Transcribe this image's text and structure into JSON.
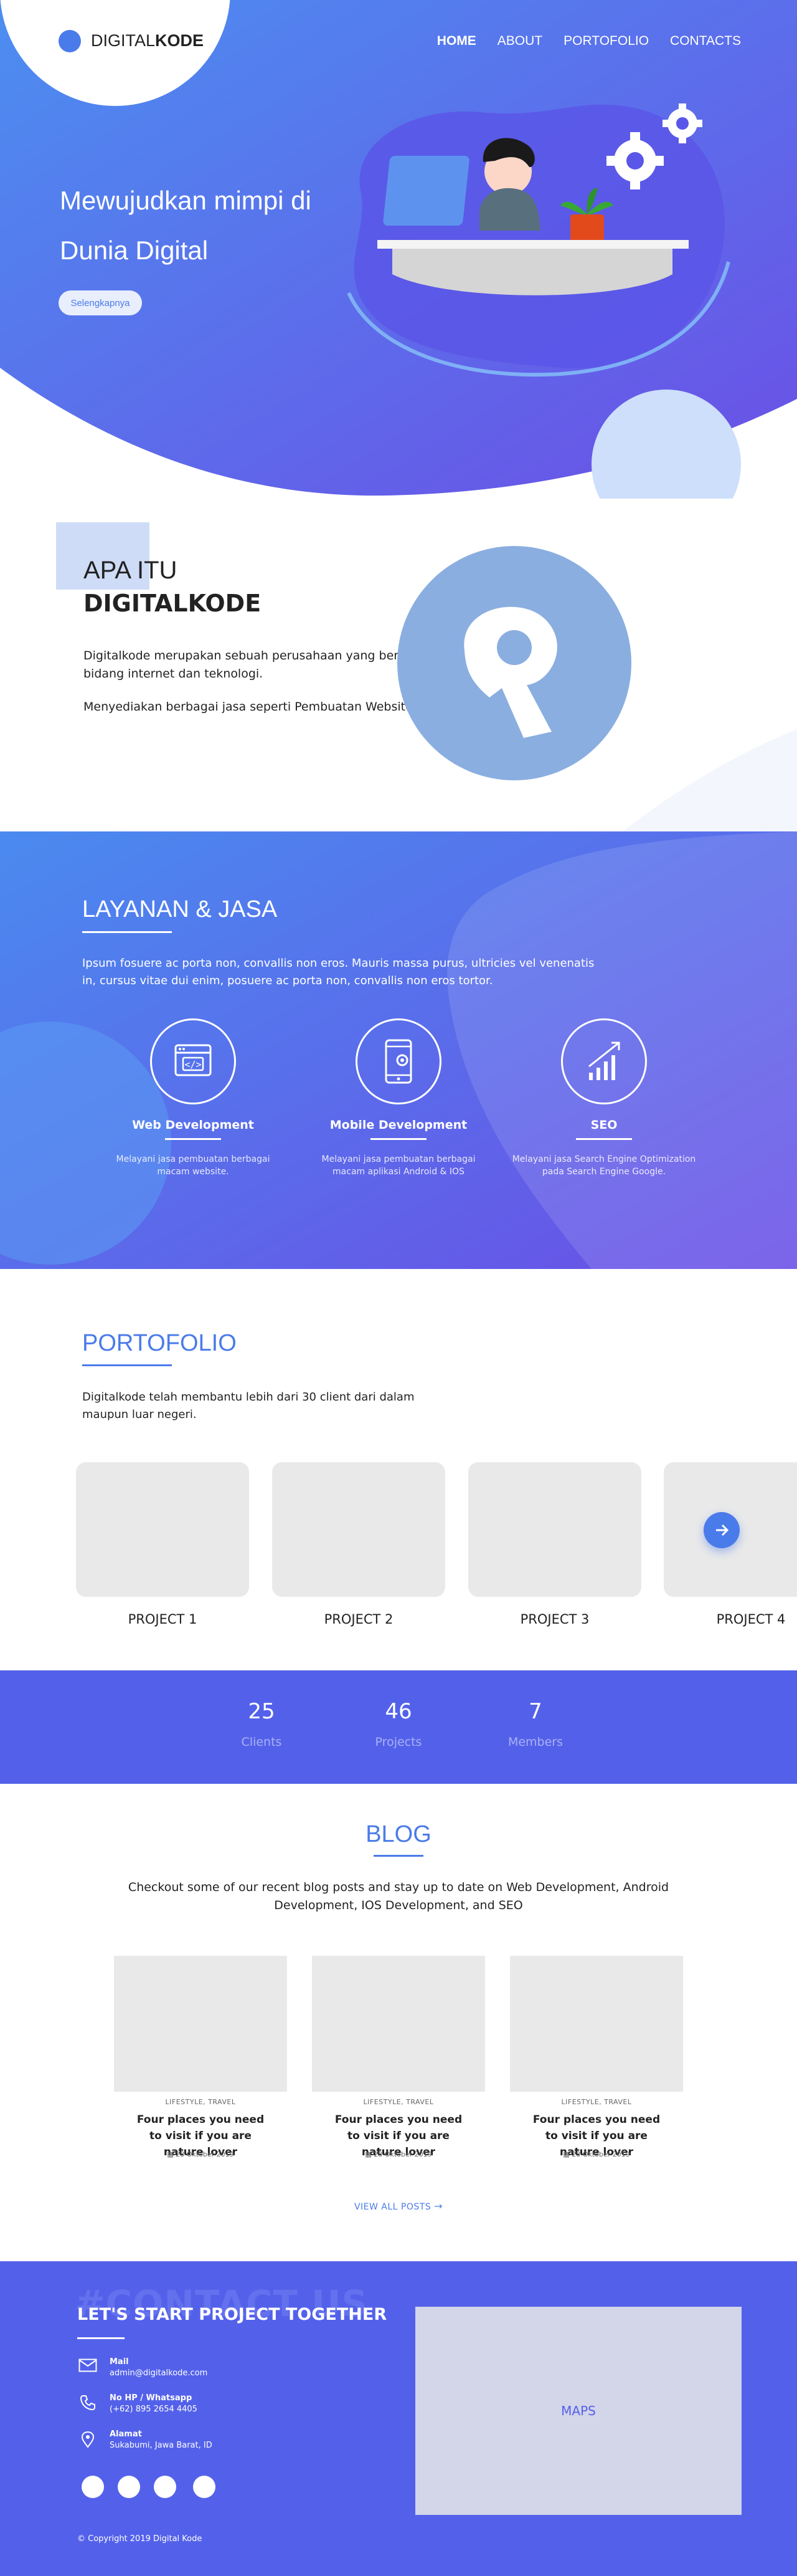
{
  "brand": {
    "prefix": "DIGITAL",
    "suffix": "KODE"
  },
  "nav": {
    "items": [
      "HOME",
      "ABOUT",
      "PORTOFOLIO",
      "CONTACTS"
    ]
  },
  "hero": {
    "line1": "Mewujudkan mimpi di",
    "line2": "Dunia Digital",
    "button": "Selengkapnya"
  },
  "about": {
    "title_light": "APA ITU",
    "title_bold": "DIGITALKODE",
    "para1": "Digitalkode merupakan sebuah perusahaan yang bergerak di bidang internet dan teknologi.",
    "para2": "Menyediakan berbagai jasa seperti Pembuatan Website, dan Aplikasi"
  },
  "services": {
    "title": "LAYANAN & JASA",
    "intro": "Ipsum fosuere ac porta non, convallis non eros. Mauris massa purus, ultricies vel venenatis in, cursus vitae dui enim, posuere ac porta non, convallis non eros tortor.",
    "items": [
      {
        "title": "Web Development",
        "desc": "Melayani jasa pembuatan berbagai macam website.",
        "icon": "browser-code-icon"
      },
      {
        "title": "Mobile Development",
        "desc": "Melayani jasa pembuatan berbagai macam aplikasi Android & IOS",
        "icon": "mobile-gear-icon"
      },
      {
        "title": "SEO",
        "desc": "Melayani jasa Search Engine Optimization pada Search Engine Google.",
        "icon": "growth-chart-icon"
      }
    ]
  },
  "portfolio": {
    "title": "PORTOFOLIO",
    "intro": "Digitalkode telah membantu lebih dari 30 client dari dalam maupun luar negeri.",
    "projects": [
      "PROJECT 1",
      "PROJECT 2",
      "PROJECT 3",
      "PROJECT 4"
    ]
  },
  "stats": [
    {
      "value": "25",
      "label": "Clients"
    },
    {
      "value": "46",
      "label": "Projects"
    },
    {
      "value": "7",
      "label": "Members"
    }
  ],
  "blog": {
    "title": "BLOG",
    "intro": "Checkout some of our recent blog posts and stay up to date on Web Development, Android Development, IOS Development, and SEO",
    "posts": [
      {
        "category": "LIFESTYLE, TRAVEL",
        "title": "Four places you need to visit if you are nature lover",
        "date": "28 Oktober 2019"
      },
      {
        "category": "LIFESTYLE, TRAVEL",
        "title": "Four places you need to visit if you are nature lover",
        "date": "28 Oktober 2019"
      },
      {
        "category": "LIFESTYLE, TRAVEL",
        "title": "Four places you need to visit if you are nature lover",
        "date": "28 Oktober 2019"
      }
    ],
    "view_all": "VIEW ALL POSTS"
  },
  "contact": {
    "watermark": "#CONTACT US",
    "title": "LET'S START PROJECT TOGETHER",
    "items": [
      {
        "label": "Mail",
        "value": "admin@digitalkode.com"
      },
      {
        "label": "No HP / Whatsapp",
        "value": "(+62) 895 2654 4405"
      },
      {
        "label": "Alamat",
        "value": "Sukabumi, Jawa Barat, ID"
      }
    ],
    "map_label": "MAPS",
    "copyright": "© Copyright 2019 Digital Kode"
  },
  "colors": {
    "primary": "#4a7bea",
    "violet": "#6a4ee6",
    "contact_bg": "#5361ea"
  }
}
